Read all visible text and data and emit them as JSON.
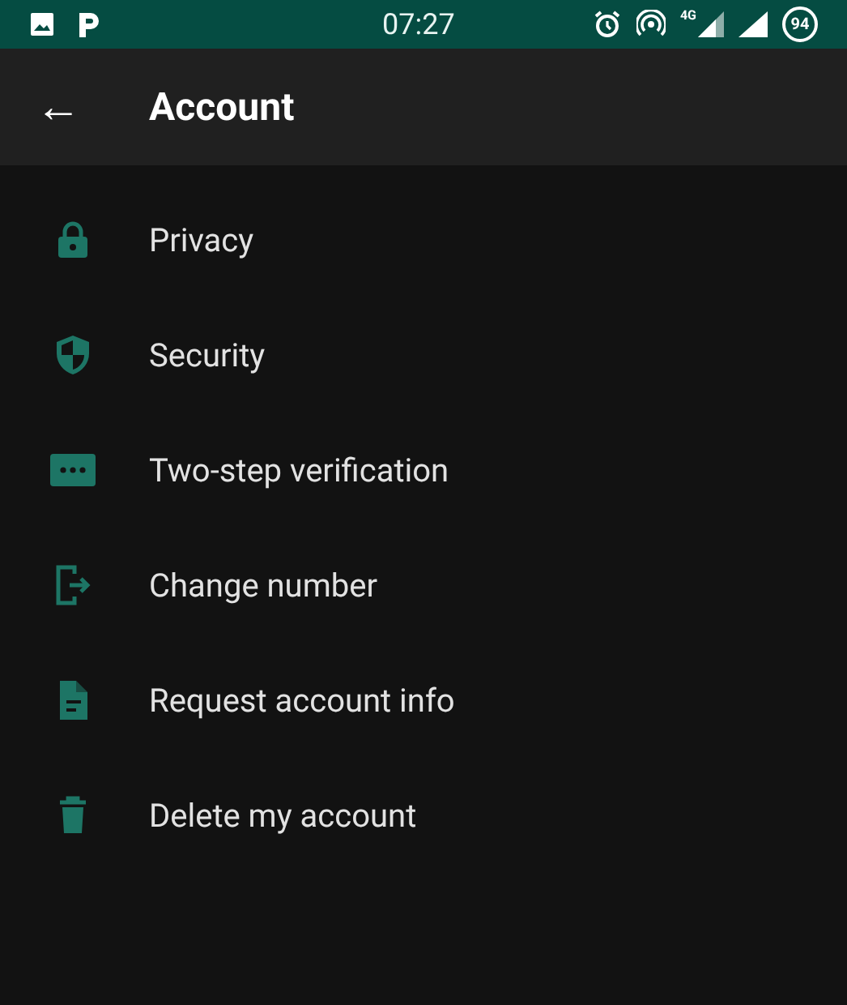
{
  "status_bar": {
    "time": "07:27",
    "network": "4G",
    "battery": "94"
  },
  "app_bar": {
    "back": "←",
    "title": "Account"
  },
  "items": [
    {
      "label": "Privacy"
    },
    {
      "label": "Security"
    },
    {
      "label": "Two-step verification"
    },
    {
      "label": "Change number"
    },
    {
      "label": "Request account info"
    },
    {
      "label": "Delete my account"
    }
  ]
}
